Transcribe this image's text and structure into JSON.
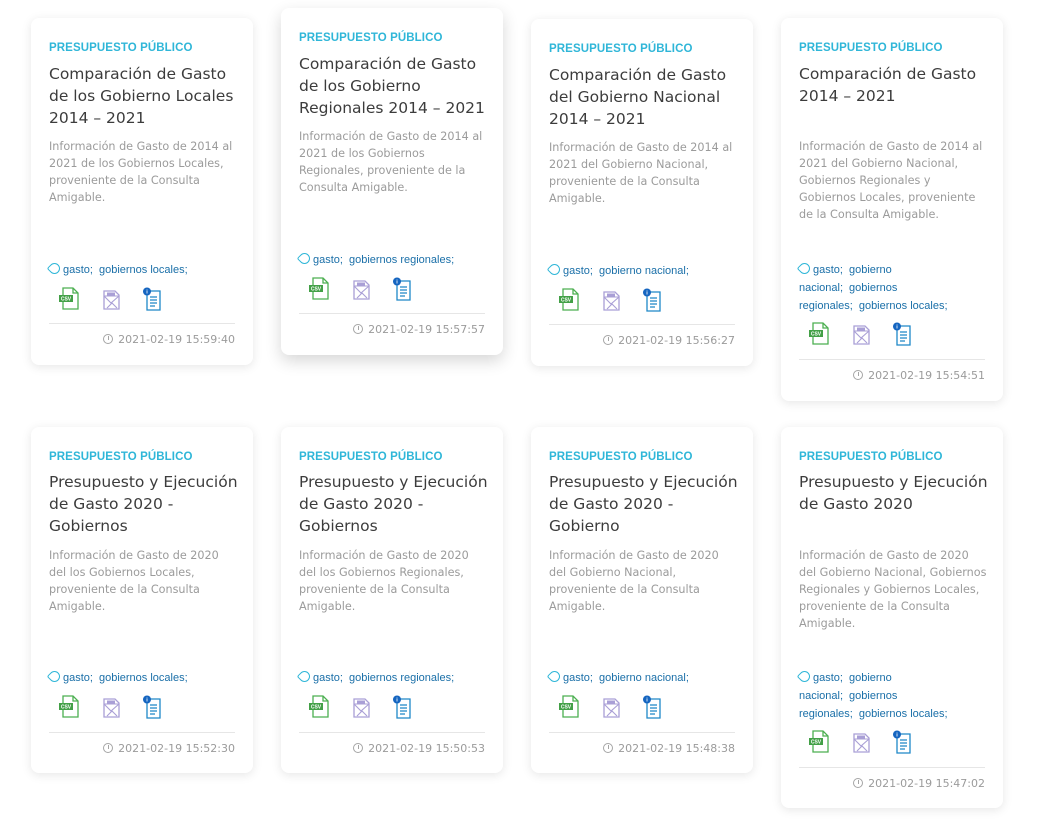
{
  "colors": {
    "category": "#2fb6d8",
    "tag": "#1a6fa8",
    "title": "#3c3c3c",
    "desc": "#9b9b9b"
  },
  "resource_icons": [
    "csv-file-icon",
    "pdf-file-icon",
    "info-document-icon"
  ],
  "cards": [
    {
      "category": "PRESUPUESTO PÚBLICO",
      "title": "Comparación de Gasto de los Gobierno Locales 2014 – 2021",
      "description": "Información de Gasto de 2014 al 2021 de los Gobiernos Locales, proveniente de la Consulta Amigable.",
      "tags": [
        "gasto",
        "gobiernos locales"
      ],
      "date": "2021-02-19 15:59:40"
    },
    {
      "category": "PRESUPUESTO PÚBLICO",
      "title": "Comparación de Gasto de los Gobierno Regionales 2014 – 2021",
      "description": "Información de Gasto de 2014 al 2021 de los Gobiernos Regionales, proveniente de la Consulta Amigable.",
      "tags": [
        "gasto",
        "gobiernos regionales"
      ],
      "date": "2021-02-19 15:57:57"
    },
    {
      "category": "PRESUPUESTO PÚBLICO",
      "title": "Comparación de Gasto del Gobierno Nacional 2014 – 2021",
      "description": "Información de Gasto de 2014 al 2021 del Gobierno Nacional, proveniente de la Consulta Amigable.",
      "tags": [
        "gasto",
        "gobierno nacional"
      ],
      "date": "2021-02-19 15:56:27"
    },
    {
      "category": "PRESUPUESTO PÚBLICO",
      "title": "Comparación de Gasto 2014 – 2021",
      "description": "Información de Gasto de 2014 al 2021 del Gobierno Nacional, Gobiernos Regionales y Gobiernos Locales, proveniente de la Consulta Amigable.",
      "tags": [
        "gasto",
        "gobierno nacional",
        "gobiernos regionales",
        "gobiernos locales"
      ],
      "date": "2021-02-19 15:54:51"
    },
    {
      "category": "PRESUPUESTO PÚBLICO",
      "title": "Presupuesto y Ejecución de Gasto 2020 - Gobiernos",
      "description": "Información de Gasto de 2020 del los Gobiernos Locales, proveniente de la Consulta Amigable.",
      "tags": [
        "gasto",
        "gobiernos locales"
      ],
      "date": "2021-02-19 15:52:30"
    },
    {
      "category": "PRESUPUESTO PÚBLICO",
      "title": "Presupuesto y Ejecución de Gasto 2020 - Gobiernos",
      "description": "Información de Gasto de 2020 del los Gobiernos Regionales, proveniente de la Consulta Amigable.",
      "tags": [
        "gasto",
        "gobiernos regionales"
      ],
      "date": "2021-02-19 15:50:53"
    },
    {
      "category": "PRESUPUESTO PÚBLICO",
      "title": "Presupuesto y Ejecución de Gasto 2020 - Gobierno",
      "description": "Información de Gasto de 2020 del Gobierno Nacional, proveniente de la Consulta Amigable.",
      "tags": [
        "gasto",
        "gobierno nacional"
      ],
      "date": "2021-02-19 15:48:38"
    },
    {
      "category": "PRESUPUESTO PÚBLICO",
      "title": "Presupuesto y Ejecución de Gasto 2020",
      "description": "Información de Gasto de 2020 del Gobierno Nacional, Gobiernos Regionales y Gobiernos Locales, proveniente de la Consulta Amigable.",
      "tags": [
        "gasto",
        "gobierno nacional",
        "gobiernos regionales",
        "gobiernos locales"
      ],
      "date": "2021-02-19 15:47:02"
    }
  ]
}
